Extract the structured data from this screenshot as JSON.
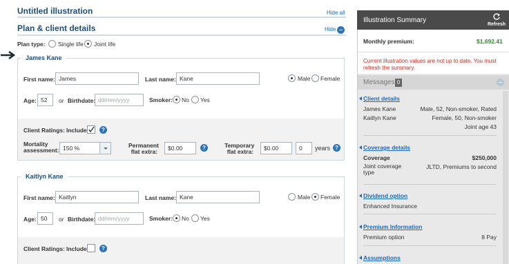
{
  "page": {
    "title": "Untitled illustration",
    "hide_all": "Hide all",
    "section_title": "Plan & client details",
    "hide": "Hide",
    "plan_type_label": "Plan type:",
    "plan_type_options": [
      "Single life",
      "Joint life"
    ],
    "plan_type_selected": "Joint life"
  },
  "client1": {
    "legend": "James Kane",
    "first_name_label": "First name:",
    "first_name": "James",
    "last_name_label": "Last name:",
    "last_name": "Kane",
    "male_label": "Male",
    "female_label": "Female",
    "gender": "Male",
    "age_label": "Age:",
    "age": "52",
    "or_label": "or",
    "birthdate_label": "Birthdate:",
    "birthdate_placeholder": "dd/mm/yyyy",
    "smoker_label": "Smoker:",
    "no_label": "No",
    "yes_label": "Yes",
    "smoker": "No",
    "ratings_label": "Client Ratings:",
    "include_label": "Include",
    "include_checked": true,
    "mortality_label_1": "Mortality",
    "mortality_label_2": "assessment:",
    "mortality_value": "150 %",
    "perm_label_1": "Permanent",
    "perm_label_2": "flat extra:",
    "perm_value": "$0.00",
    "temp_label_1": "Temporary",
    "temp_label_2": "flat extra:",
    "temp_value": "$0.00",
    "years_value": "0",
    "years_label": "years"
  },
  "client2": {
    "legend": "Kaitlyn Kane",
    "first_name_label": "First name:",
    "first_name": "Kaitlyn",
    "last_name_label": "Last name:",
    "last_name": "Kane",
    "male_label": "Male",
    "female_label": "Female",
    "gender": "Female",
    "age_label": "Age:",
    "age": "50",
    "or_label": "or",
    "birthdate_label": "Birthdate:",
    "birthdate_placeholder": "dd/mm/yyyy",
    "smoker_label": "Smoker:",
    "no_label": "No",
    "yes_label": "Yes",
    "smoker": "No",
    "ratings_label": "Client Ratings:",
    "include_label": "Include",
    "include_checked": false
  },
  "summary": {
    "title": "Illustration Summary",
    "refresh": "Refresh",
    "premium_label": "Monthly premium:",
    "premium_value": "$1,692.41",
    "warning": "Current illustration values are not up to date. You must refresh the summary.",
    "messages_label": "Messages",
    "messages_count": "0",
    "client_details_title": "Client details",
    "client_rows": [
      {
        "name": "James Kane",
        "desc": "Male, 52, Non-smoker, Rated"
      },
      {
        "name": "Kaitlyn Kane",
        "desc": "Female, 50, Non-smoker"
      }
    ],
    "joint_age": "Joint age 43",
    "coverage_title": "Coverage details",
    "coverage_label": "Coverage",
    "coverage_value": "$250,000",
    "joint_type_label_1": "Joint coverage",
    "joint_type_label_2": "type",
    "joint_type_value": "JLTD, Premiums to second",
    "dividend_title": "Dividend option",
    "dividend_value": "Enhanced Insurance",
    "premium_info_title": "Premium Information",
    "premium_option_label": "Premium option",
    "premium_option_value": "8 Pay",
    "assumptions_title": "Assumptions"
  },
  "colors": {
    "accent": "#1f4e79",
    "link": "#1a6ab8",
    "premium_green": "#2e8b2e",
    "warning_red": "#d9261c",
    "panel_header": "#4a4a4a"
  }
}
